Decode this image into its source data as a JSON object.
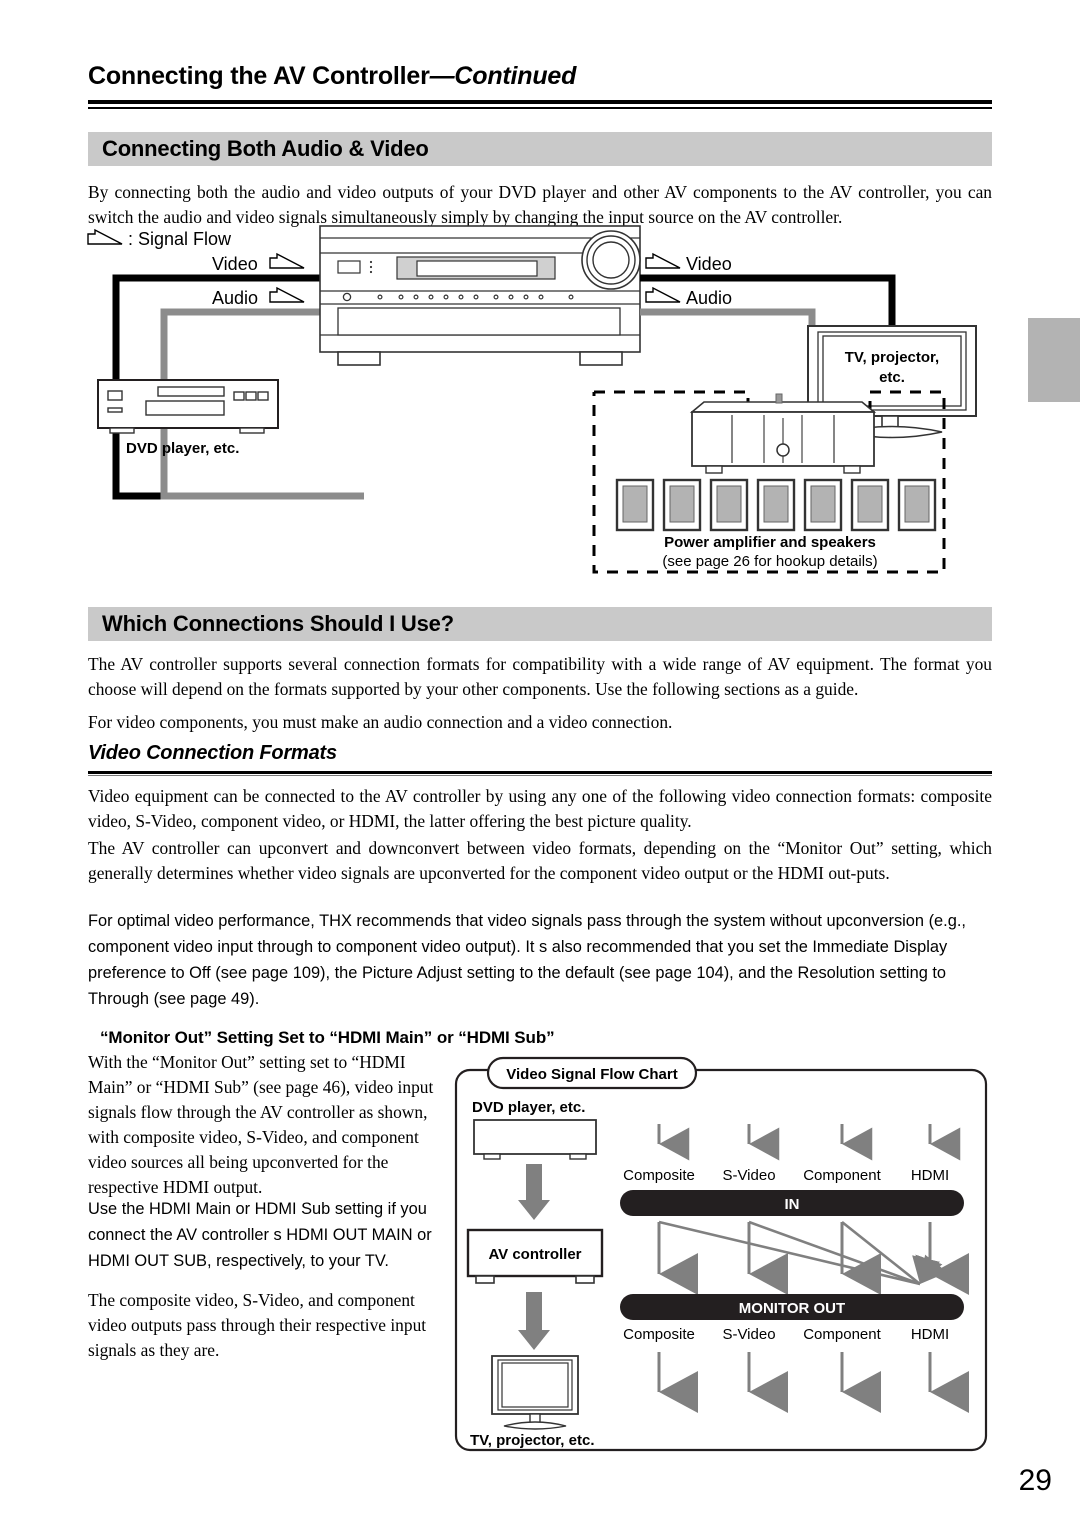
{
  "page": {
    "running_head_main": "Connecting the AV Controller",
    "running_head_cont": "—Continued",
    "page_number": "29"
  },
  "section1": {
    "title": "Connecting Both Audio & Video",
    "intro": "By connecting both the audio and video outputs of your DVD player and other AV components to the AV controller, you can switch the audio and video signals simultaneously simply by changing the input source on the AV controller.",
    "diagram": {
      "legend": ": Signal Flow",
      "video_label_left": "Video",
      "audio_label_left": "Audio",
      "video_label_right": "Video",
      "audio_label_right": "Audio",
      "dvd_label": "DVD player, etc.",
      "tv_label_line1": "TV, projector,",
      "tv_label_line2": "etc.",
      "amp_label": "Power amplifier and speakers",
      "amp_sublabel": "(see page 26 for hookup details)"
    }
  },
  "section2": {
    "title": "Which Connections Should I Use?",
    "p1": "The AV controller supports several connection formats for compatibility with a wide range of AV equipment. The format you choose will depend on the formats supported by your other components. Use the following sections as a guide.",
    "p2": "For video components, you must make an audio connection and a video connection.",
    "subhead": "Video Connection Formats",
    "p3": "Video equipment can be connected to the AV controller by using any one of the following video connection formats: composite video, S-Video, component video, or HDMI, the latter offering the best picture quality.",
    "p4": "The AV controller can upconvert and downconvert between video formats, depending on the “Monitor Out” setting, which generally determines whether video signals are upconverted for the component video output or the HDMI out-puts.",
    "p5": "For optimal video performance, THX recommends that video signals pass through the system without upconversion (e.g., component video input through to component video output). It s also recommended that you set the  Immediate Display  preference to  Off  (see page 109), the  Picture Adjust  setting to the default (see page 104), and the  Resolution  setting to  Through  (see page 49).",
    "monitor_out_head": "“Monitor Out” Setting Set to “HDMI Main” or “HDMI Sub”",
    "p6a": "With the “Monitor Out” setting set to “HDMI Main” or “HDMI Sub” (see page 46), video input signals flow through the AV controller as shown, with composite video, S-Video, and component video sources all being upconverted for the respective HDMI output. ",
    "p6b": "Use the  HDMI Main  or  HDMI Sub  setting if you connect the AV controller s HDMI OUT MAIN or HDMI OUT SUB, respectively, to your TV.",
    "p7": "The composite video, S-Video, and component video outputs pass through their respective input signals as they are."
  },
  "chart_data": {
    "type": "diagram",
    "title": "Video Signal Flow Chart",
    "source_label": "DVD player, etc.",
    "device_label": "AV controller",
    "sink_label": "TV, projector, etc.",
    "in_bar_label": "IN",
    "out_bar_label": "MONITOR OUT",
    "in_ports": [
      "Composite",
      "S-Video",
      "Component",
      "HDMI"
    ],
    "out_ports": [
      "Composite",
      "S-Video",
      "Component",
      "HDMI"
    ],
    "routes": [
      {
        "from": "Composite",
        "to": "Composite"
      },
      {
        "from": "S-Video",
        "to": "S-Video"
      },
      {
        "from": "Component",
        "to": "Component"
      },
      {
        "from": "HDMI",
        "to": "HDMI"
      },
      {
        "from": "Composite",
        "to": "HDMI"
      },
      {
        "from": "S-Video",
        "to": "HDMI"
      },
      {
        "from": "Component",
        "to": "HDMI"
      }
    ],
    "colors": {
      "bar": "#231f20",
      "arrow": "#808080",
      "line": "#707070"
    }
  }
}
